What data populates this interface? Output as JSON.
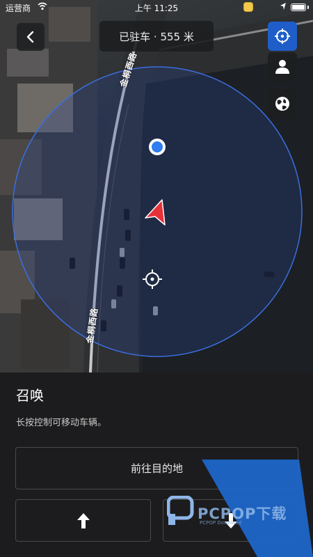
{
  "status_bar": {
    "carrier": "运营商",
    "time": "上午 11:25"
  },
  "header": {
    "status_pill": "已驻车 · 555 米"
  },
  "map": {
    "road_name_top": "金桐西路",
    "road_name_bottom": "金桐西路"
  },
  "icons": {
    "back": "chevron-left-icon",
    "locate": "crosshair-icon",
    "person": "person-icon",
    "globe": "globe-icon"
  },
  "sheet": {
    "title": "召唤",
    "description": "长按控制可移动车辆。",
    "destination_button": "前往目的地"
  },
  "watermark": {
    "brand": "PCPOP下载",
    "sub": "PCPOP Download"
  },
  "colors": {
    "accent_blue": "#1f5ec9",
    "vehicle_red": "#e8303a",
    "sheet_bg": "#1c1c1e"
  }
}
